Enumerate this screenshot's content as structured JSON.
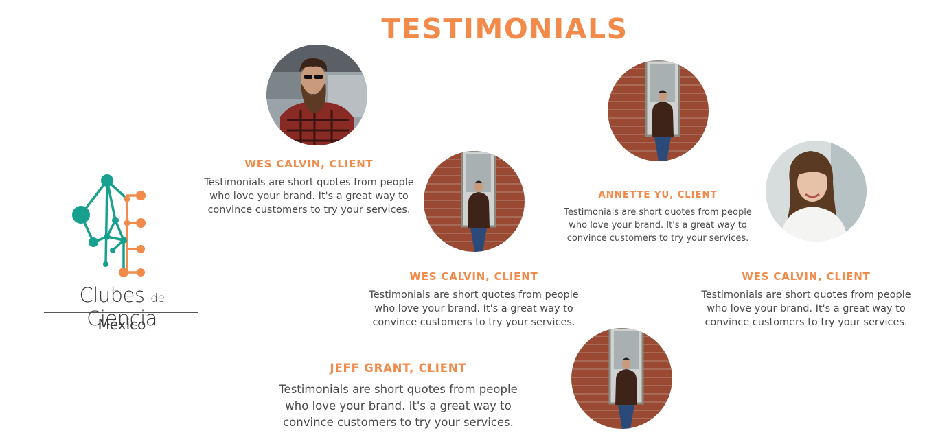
{
  "page_title": "TESTIMONIALS",
  "logo": {
    "word_1": "Clubes",
    "word_de": "de",
    "word_2": "Ciencia",
    "subtitle": "México",
    "colors": {
      "teal": "#17a08e",
      "orange": "#f28a4a"
    }
  },
  "testimonials": [
    {
      "name": "WES CALVIN, CLIENT",
      "quote_lines": [
        "Testimonials are short quotes from people",
        "who love your brand. It's a great way to",
        "convince customers to try your services."
      ],
      "photo": "bearded-man-photo"
    },
    {
      "name": "WES CALVIN, CLIENT",
      "quote_lines": [
        "Testimonials are short quotes from people",
        "who love your brand. It's a great way to",
        "convince customers to try your services."
      ],
      "photo": "man-brick-wall-photo"
    },
    {
      "name": "ANNETTE YU, CLIENT",
      "quote_lines": [
        "Testimonials are short quotes from people",
        "who love your brand. It's a great way to",
        "convince customers to try your services."
      ],
      "photo": "woman-white-shirt-photo"
    },
    {
      "name": "WES CALVIN, CLIENT",
      "quote_lines": [
        "Testimonials are short quotes from people",
        "who love your brand. It's a great way to",
        "convince customers to try your services."
      ],
      "photo": "man-brick-wall-photo"
    },
    {
      "name": "JEFF GRANT, CLIENT",
      "quote_lines": [
        "Testimonials are short quotes from people",
        "who love your brand. It's a great way to",
        "convince customers to try your services."
      ],
      "photo": "man-brick-wall-photo"
    }
  ],
  "accent_color": "#f28a4a"
}
